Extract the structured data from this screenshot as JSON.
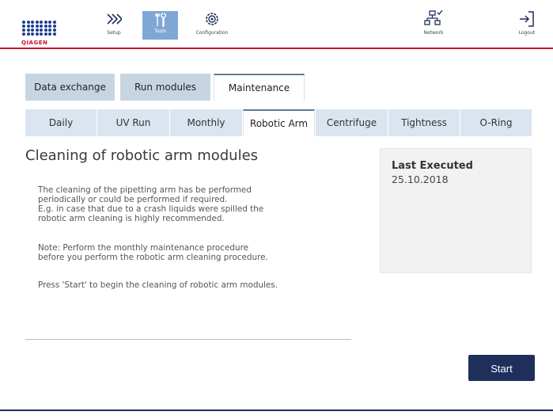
{
  "brand": {
    "name": "QIAGEN",
    "accent": "#c8102e",
    "navy": "#1e2f5c"
  },
  "nav": {
    "setup": "Setup",
    "tools": "Tools",
    "configuration": "Configuration",
    "network": "Network",
    "logout": "Logout"
  },
  "main_tabs": [
    "Data exchange",
    "Run modules",
    "Maintenance"
  ],
  "main_tab_active": "Maintenance",
  "sub_tabs": [
    "Daily",
    "UV Run",
    "Monthly",
    "Robotic Arm",
    "Centrifuge",
    "Tightness",
    "O-Ring"
  ],
  "sub_tab_active": "Robotic Arm",
  "content": {
    "title": "Cleaning of robotic arm modules",
    "para1": [
      "The cleaning of the pipetting arm has be performed",
      "periodically or could be performed if required.",
      "E.g. in case that due to a crash liquids were spilled the",
      "robotic arm cleaning is highly recommended."
    ],
    "para2": [
      "Note: Perform the monthly maintenance procedure",
      "before you perform the robotic arm cleaning procedure."
    ],
    "para3": [
      "Press 'Start' to begin the cleaning of robotic arm modules."
    ]
  },
  "last_executed": {
    "label": "Last Executed",
    "date": "25.10.2018"
  },
  "start_button": "Start"
}
